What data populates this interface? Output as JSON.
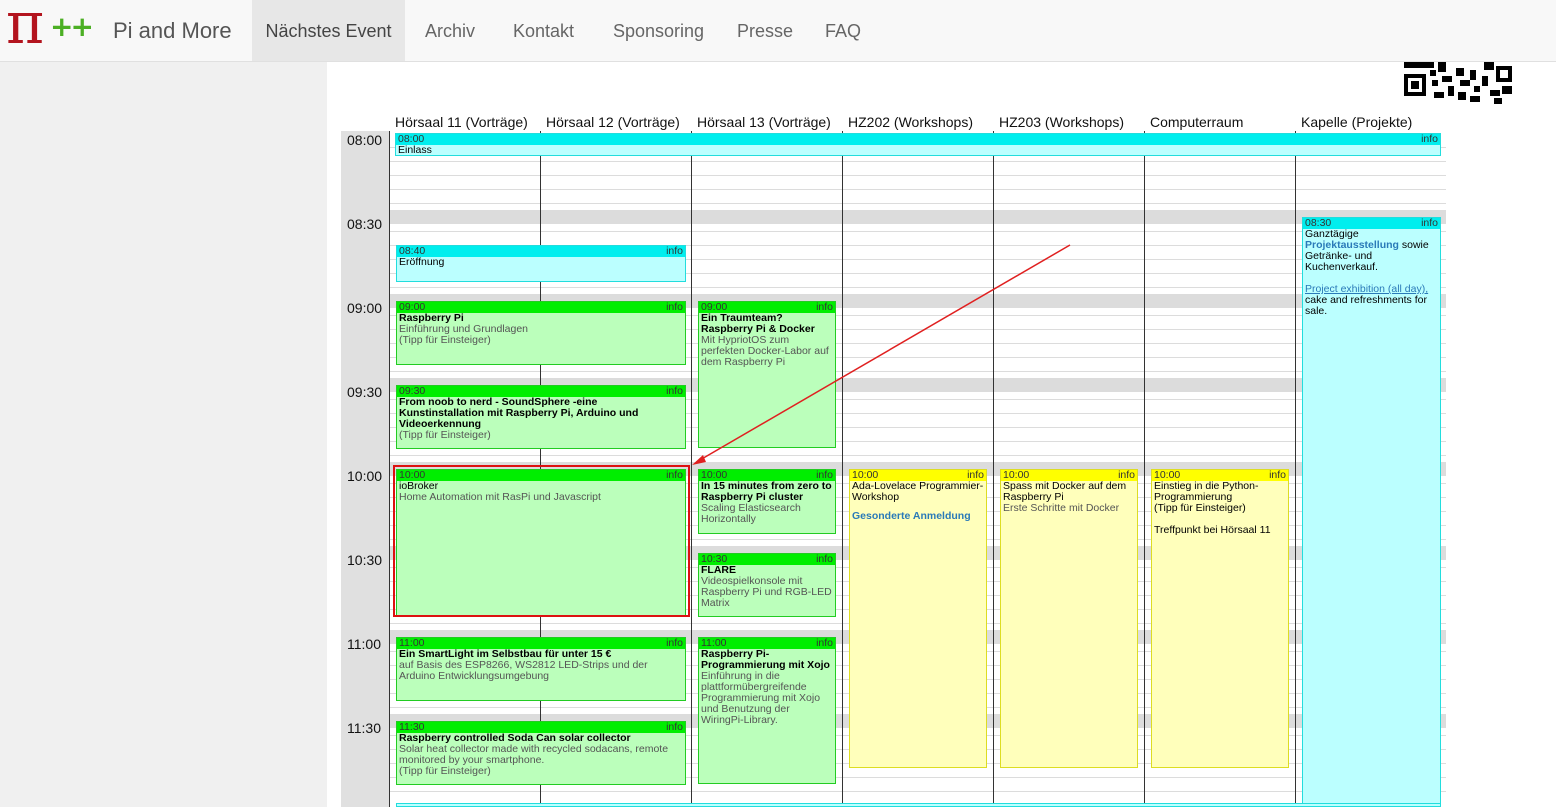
{
  "nav": {
    "brand": "Pi and More",
    "items": [
      "Nächstes Event",
      "Archiv",
      "Kontakt",
      "Sponsoring",
      "Presse",
      "FAQ"
    ]
  },
  "rooms": [
    "Hörsaal 11 (Vorträge)",
    "Hörsaal 12 (Vorträge)",
    "Hörsaal 13 (Vorträge)",
    "HZ202 (Workshops)",
    "HZ203 (Workshops)",
    "Computerraum",
    "Kapelle (Projekte)"
  ],
  "times": [
    "08:00",
    "08:30",
    "09:00",
    "09:30",
    "10:00",
    "10:30",
    "11:00",
    "11:30"
  ],
  "info_label": "info",
  "events": {
    "einlass": {
      "time": "08:00",
      "title": "Einlass"
    },
    "kapelle": {
      "time": "08:30",
      "line1": "Ganztägige",
      "link1": "Projektausstellung",
      "rest1": " sowie Getränke- und Kuchenverkauf.",
      "link2": "Project exhibition (all day),",
      "rest2": " cake and refreshments for sale."
    },
    "eroeffnung": {
      "time": "08:40",
      "title": "Eröffnung"
    },
    "raspi": {
      "time": "09:00",
      "title": "Raspberry Pi",
      "sub": "Einführung und Grundlagen",
      "note": "(Tipp für Einsteiger)"
    },
    "traumteam": {
      "time": "09:00",
      "title": "Ein Traumteam? Raspberry Pi & Docker",
      "sub": "Mit HypriotOS zum perfekten Docker-Labor auf dem Raspberry Pi"
    },
    "noob": {
      "time": "09:30",
      "title": "From noob to nerd - SoundSphere -eine Kunstinstallation mit Raspberry Pi, Arduino und Videoerkennung",
      "note": "(Tipp für Einsteiger)"
    },
    "iobroker": {
      "time": "10:00",
      "title": "ioBroker",
      "sub": "Home Automation mit RasPi und Javascript"
    },
    "fifteen": {
      "time": "10:00",
      "title": "In 15 minutes from zero to Raspberry Pi cluster",
      "sub": "Scaling Elasticsearch Horizontally"
    },
    "ada": {
      "time": "10:00",
      "title": "Ada-Lovelace Programmier-Workshop",
      "link": "Gesonderte Anmeldung"
    },
    "spass": {
      "time": "10:00",
      "title": "Spass mit Docker auf dem Raspberry Pi",
      "sub": "Erste Schritte mit Docker"
    },
    "python": {
      "time": "10:00",
      "title": "Einstieg in die Python-Programmierung",
      "note": "(Tipp für Einsteiger)",
      "extra": "Treffpunkt bei Hörsaal 11"
    },
    "flare": {
      "time": "10:30",
      "title": "FLARE",
      "sub": "Videospielkonsole mit Raspberry Pi und RGB-LED Matrix"
    },
    "smartlight": {
      "time": "11:00",
      "title": "Ein SmartLight im Selbstbau für unter 15 €",
      "sub": "auf Basis des ESP8266, WS2812 LED-Strips und der Arduino Entwicklungsumgebung"
    },
    "xojo": {
      "time": "11:00",
      "title": "Raspberry Pi-Programmierung mit Xojo",
      "sub": "Einführung in die plattformübergreifende Programmierung mit Xojo und Benutzung der WiringPi-Library."
    },
    "soda": {
      "time": "11:30",
      "title": "Raspberry controlled Soda Can solar collector",
      "sub": "Solar heat collector made with recycled sodacans, remote monitored by your smartphone.",
      "note": "(Tipp für Einsteiger)"
    }
  },
  "colors": {
    "talk": "#bbffbb",
    "workshop": "#ffffbb",
    "general": "#bbffff",
    "highlight": "#dd1111"
  }
}
